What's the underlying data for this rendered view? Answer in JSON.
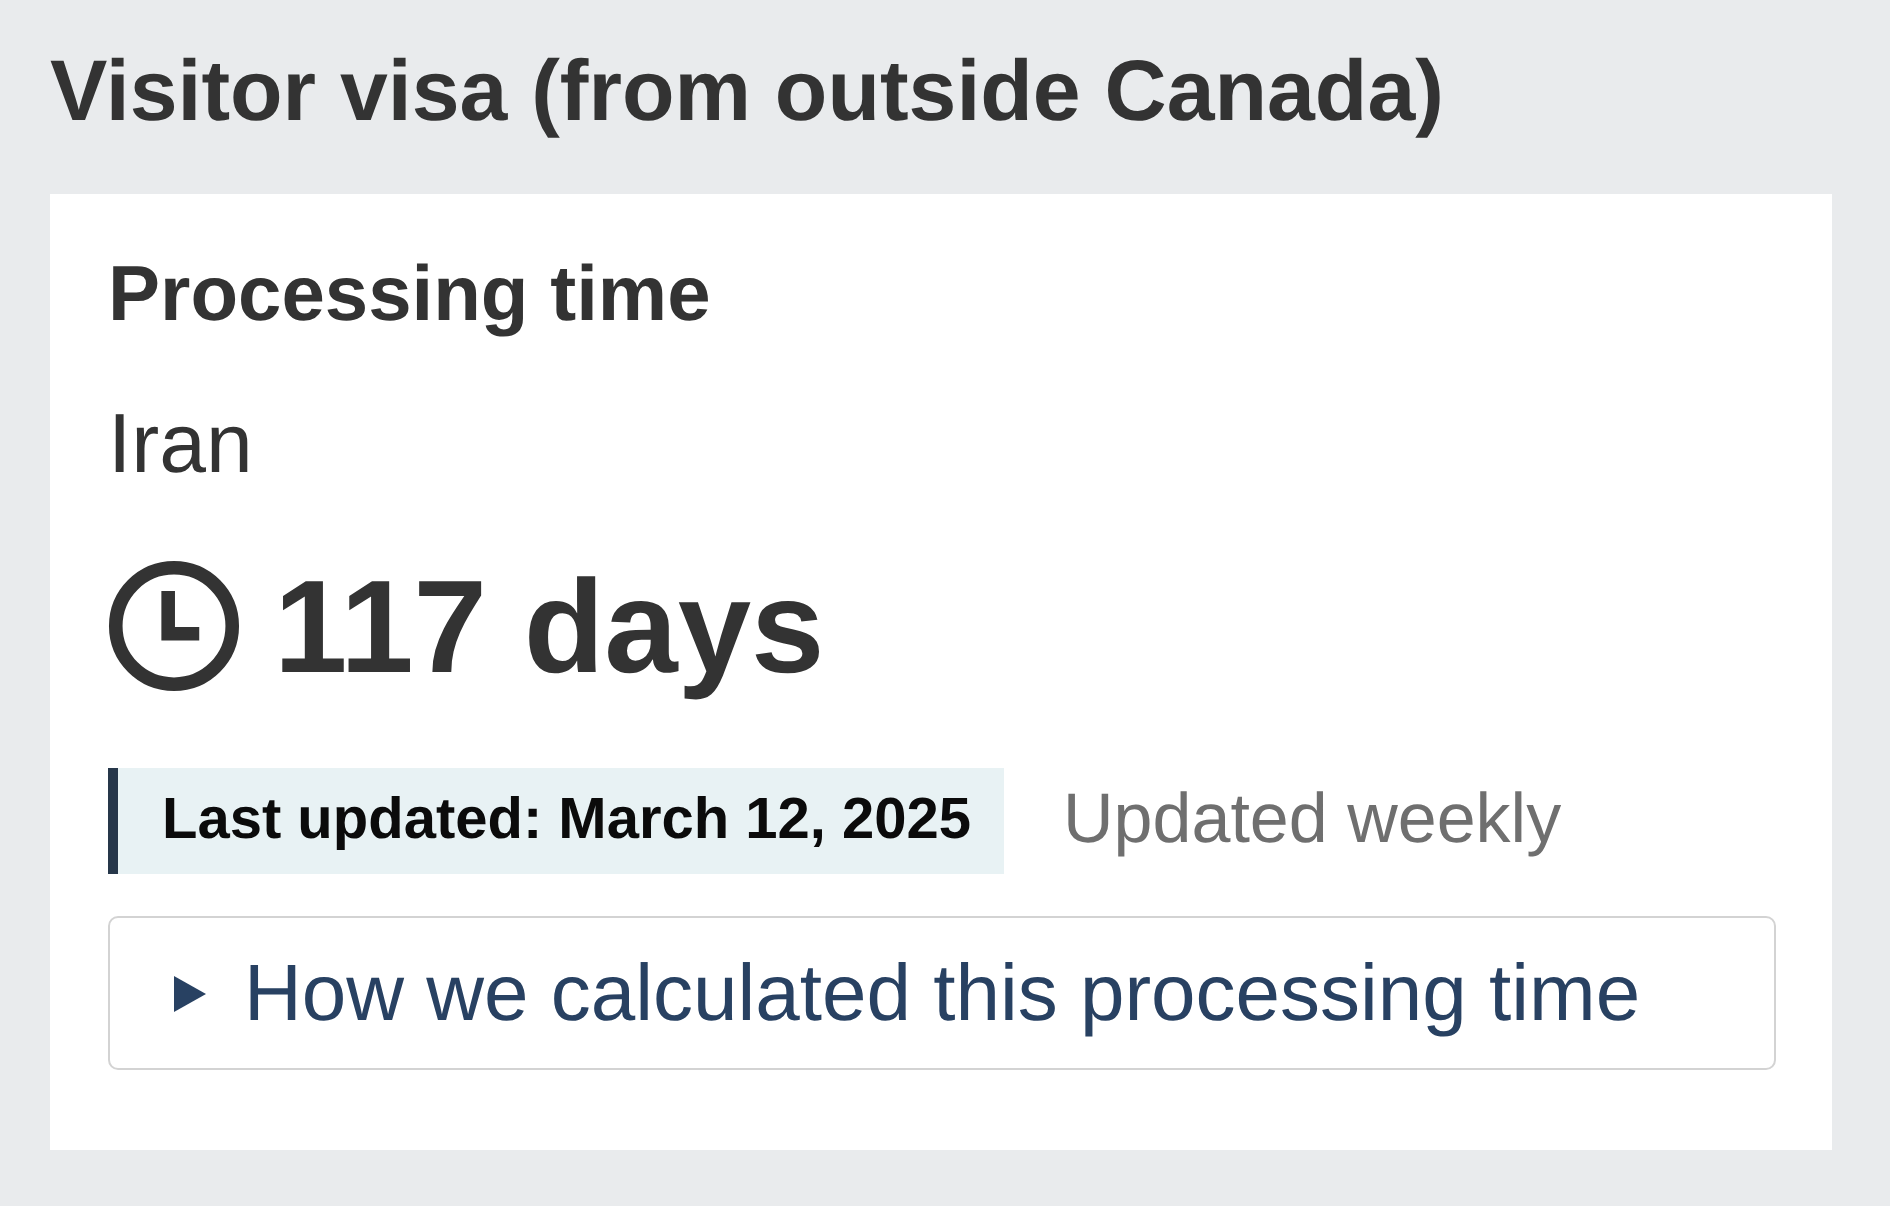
{
  "page_title": "Visitor visa (from outside Canada)",
  "card": {
    "heading": "Processing time",
    "country": "Iran",
    "processing_time": "117 days",
    "last_updated": "Last updated: March 12, 2025",
    "update_frequency": "Updated weekly",
    "details": {
      "summary": "How we calculated this processing time",
      "expanded": false
    }
  }
}
